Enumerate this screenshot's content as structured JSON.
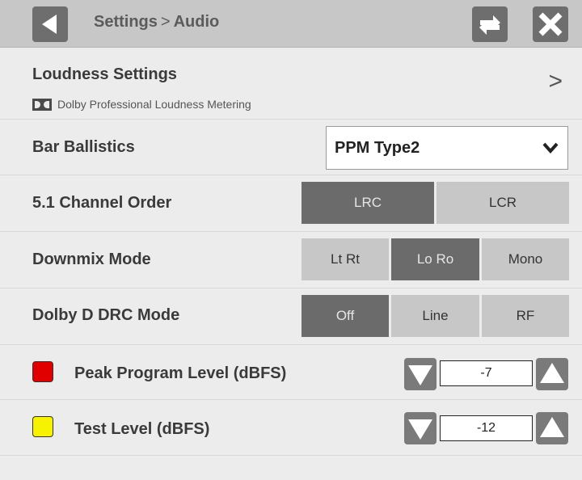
{
  "header": {
    "breadcrumb_parent": "Settings",
    "breadcrumb_separator": ">",
    "breadcrumb_current": "Audio",
    "back_icon": "back-arrow-icon",
    "swap_icon": "swap-icon",
    "close_icon": "close-icon"
  },
  "loudness": {
    "title": "Loudness Settings",
    "subtitle": "Dolby Professional Loudness Metering",
    "chevron": ">"
  },
  "bar_ballistics": {
    "label": "Bar Ballistics",
    "selected": "PPM Type2"
  },
  "channel_order": {
    "label": "5.1 Channel Order",
    "options": [
      "LRC",
      "LCR"
    ],
    "selected": "LRC"
  },
  "downmix": {
    "label": "Downmix Mode",
    "options": [
      "Lt Rt",
      "Lo Ro",
      "Mono"
    ],
    "selected": "Lo Ro"
  },
  "drc": {
    "label": "Dolby D DRC Mode",
    "options": [
      "Off",
      "Line",
      "RF"
    ],
    "selected": "Off"
  },
  "peak_level": {
    "label": "Peak Program Level (dBFS)",
    "value": "-7",
    "color": "#e00000"
  },
  "test_level": {
    "label": "Test Level (dBFS)",
    "value": "-12",
    "color": "#f7f200"
  },
  "colors": {
    "header_bg": "#c7c7c7",
    "button_active": "#6b6b6b",
    "button_inactive": "#c7c7c7"
  }
}
